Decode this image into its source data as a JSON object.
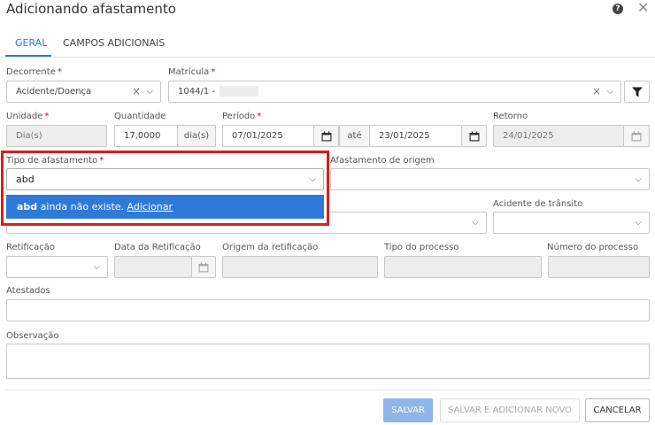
{
  "header": {
    "title": "Adicionando afastamento",
    "help_icon": "?",
    "close_icon": "✕"
  },
  "tabs": [
    {
      "label": "GERAL",
      "active": true
    },
    {
      "label": "CAMPOS ADICIONAIS",
      "active": false
    }
  ],
  "form": {
    "decorrente": {
      "label": "Decorrente",
      "value": "Acidente/Doença"
    },
    "matricula": {
      "label": "Matrícula",
      "value": "1044/1 -"
    },
    "unidade": {
      "label": "Unidade",
      "value": "Dia(s)"
    },
    "quantidade": {
      "label": "Quantidade",
      "value": "17,0000",
      "unit": "dia(s)"
    },
    "periodo": {
      "label": "Período",
      "start": "07/01/2025",
      "sep": "até",
      "end": "23/01/2025"
    },
    "retorno": {
      "label": "Retorno",
      "value": "24/01/2025"
    },
    "tipo_afastamento": {
      "label": "Tipo de afastamento",
      "value": "abd",
      "option_bold": "abd",
      "option_text": " ainda não existe. ",
      "option_link": "Adicionar"
    },
    "afastamento_origem": {
      "label": "Afastamento de origem"
    },
    "acidente_transito": {
      "label": "Acidente de trânsito"
    },
    "retificacao": {
      "label": "Retificação"
    },
    "data_retificacao": {
      "label": "Data da Retificação"
    },
    "origem_retificacao": {
      "label": "Origem da retificação"
    },
    "tipo_processo": {
      "label": "Tipo do processo"
    },
    "numero_processo": {
      "label": "Número do processo"
    },
    "atestados": {
      "label": "Atestados"
    },
    "observacao": {
      "label": "Observação"
    }
  },
  "buttons": {
    "save": "SALVAR",
    "save_new": "SALVAR E ADICIONAR NOVO",
    "cancel": "CANCELAR"
  },
  "colors": {
    "accent": "#2f7ad8",
    "highlight": "#dd1c1c",
    "required": "#d0021b"
  }
}
